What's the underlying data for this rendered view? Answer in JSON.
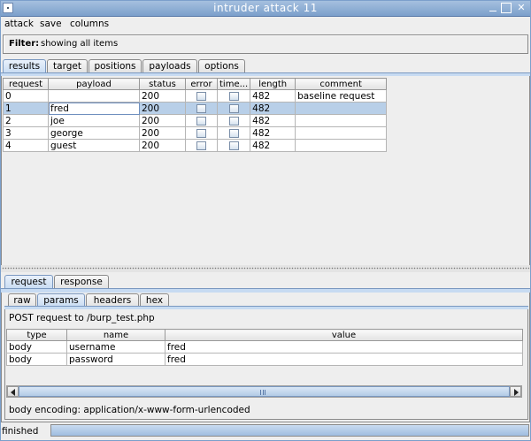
{
  "window": {
    "title": "intruder attack 11"
  },
  "menu": [
    "attack",
    "save",
    "columns"
  ],
  "filter": {
    "label": "Filter:",
    "text": "showing all items"
  },
  "main_tabs": [
    "results",
    "target",
    "positions",
    "payloads",
    "options"
  ],
  "results": {
    "columns": [
      "request",
      "payload",
      "status",
      "error",
      "time...",
      "length",
      "comment"
    ],
    "rows": [
      {
        "request": "0",
        "payload": "",
        "status": "200",
        "error": false,
        "timeout": false,
        "length": "482",
        "comment": "baseline request"
      },
      {
        "request": "1",
        "payload": "fred",
        "status": "200",
        "error": false,
        "timeout": false,
        "length": "482",
        "comment": ""
      },
      {
        "request": "2",
        "payload": "joe",
        "status": "200",
        "error": false,
        "timeout": false,
        "length": "482",
        "comment": ""
      },
      {
        "request": "3",
        "payload": "george",
        "status": "200",
        "error": false,
        "timeout": false,
        "length": "482",
        "comment": ""
      },
      {
        "request": "4",
        "payload": "guest",
        "status": "200",
        "error": false,
        "timeout": false,
        "length": "482",
        "comment": ""
      }
    ],
    "selected_row": 1
  },
  "detail_tabs": [
    "request",
    "response"
  ],
  "request_view_tabs": [
    "raw",
    "params",
    "headers",
    "hex"
  ],
  "request": {
    "summary": "POST request to /burp_test.php",
    "param_columns": [
      "type",
      "name",
      "value"
    ],
    "params": [
      {
        "type": "body",
        "name": "username",
        "value": "fred"
      },
      {
        "type": "body",
        "name": "password",
        "value": "fred"
      }
    ],
    "encoding": "body encoding:  application/x-www-form-urlencoded"
  },
  "status": {
    "text": "finished",
    "progress": 1.0
  },
  "colors": {
    "accent": "#c7dbf2",
    "selection": "#b8cfe8",
    "titlebar": "#7b9fcb"
  }
}
